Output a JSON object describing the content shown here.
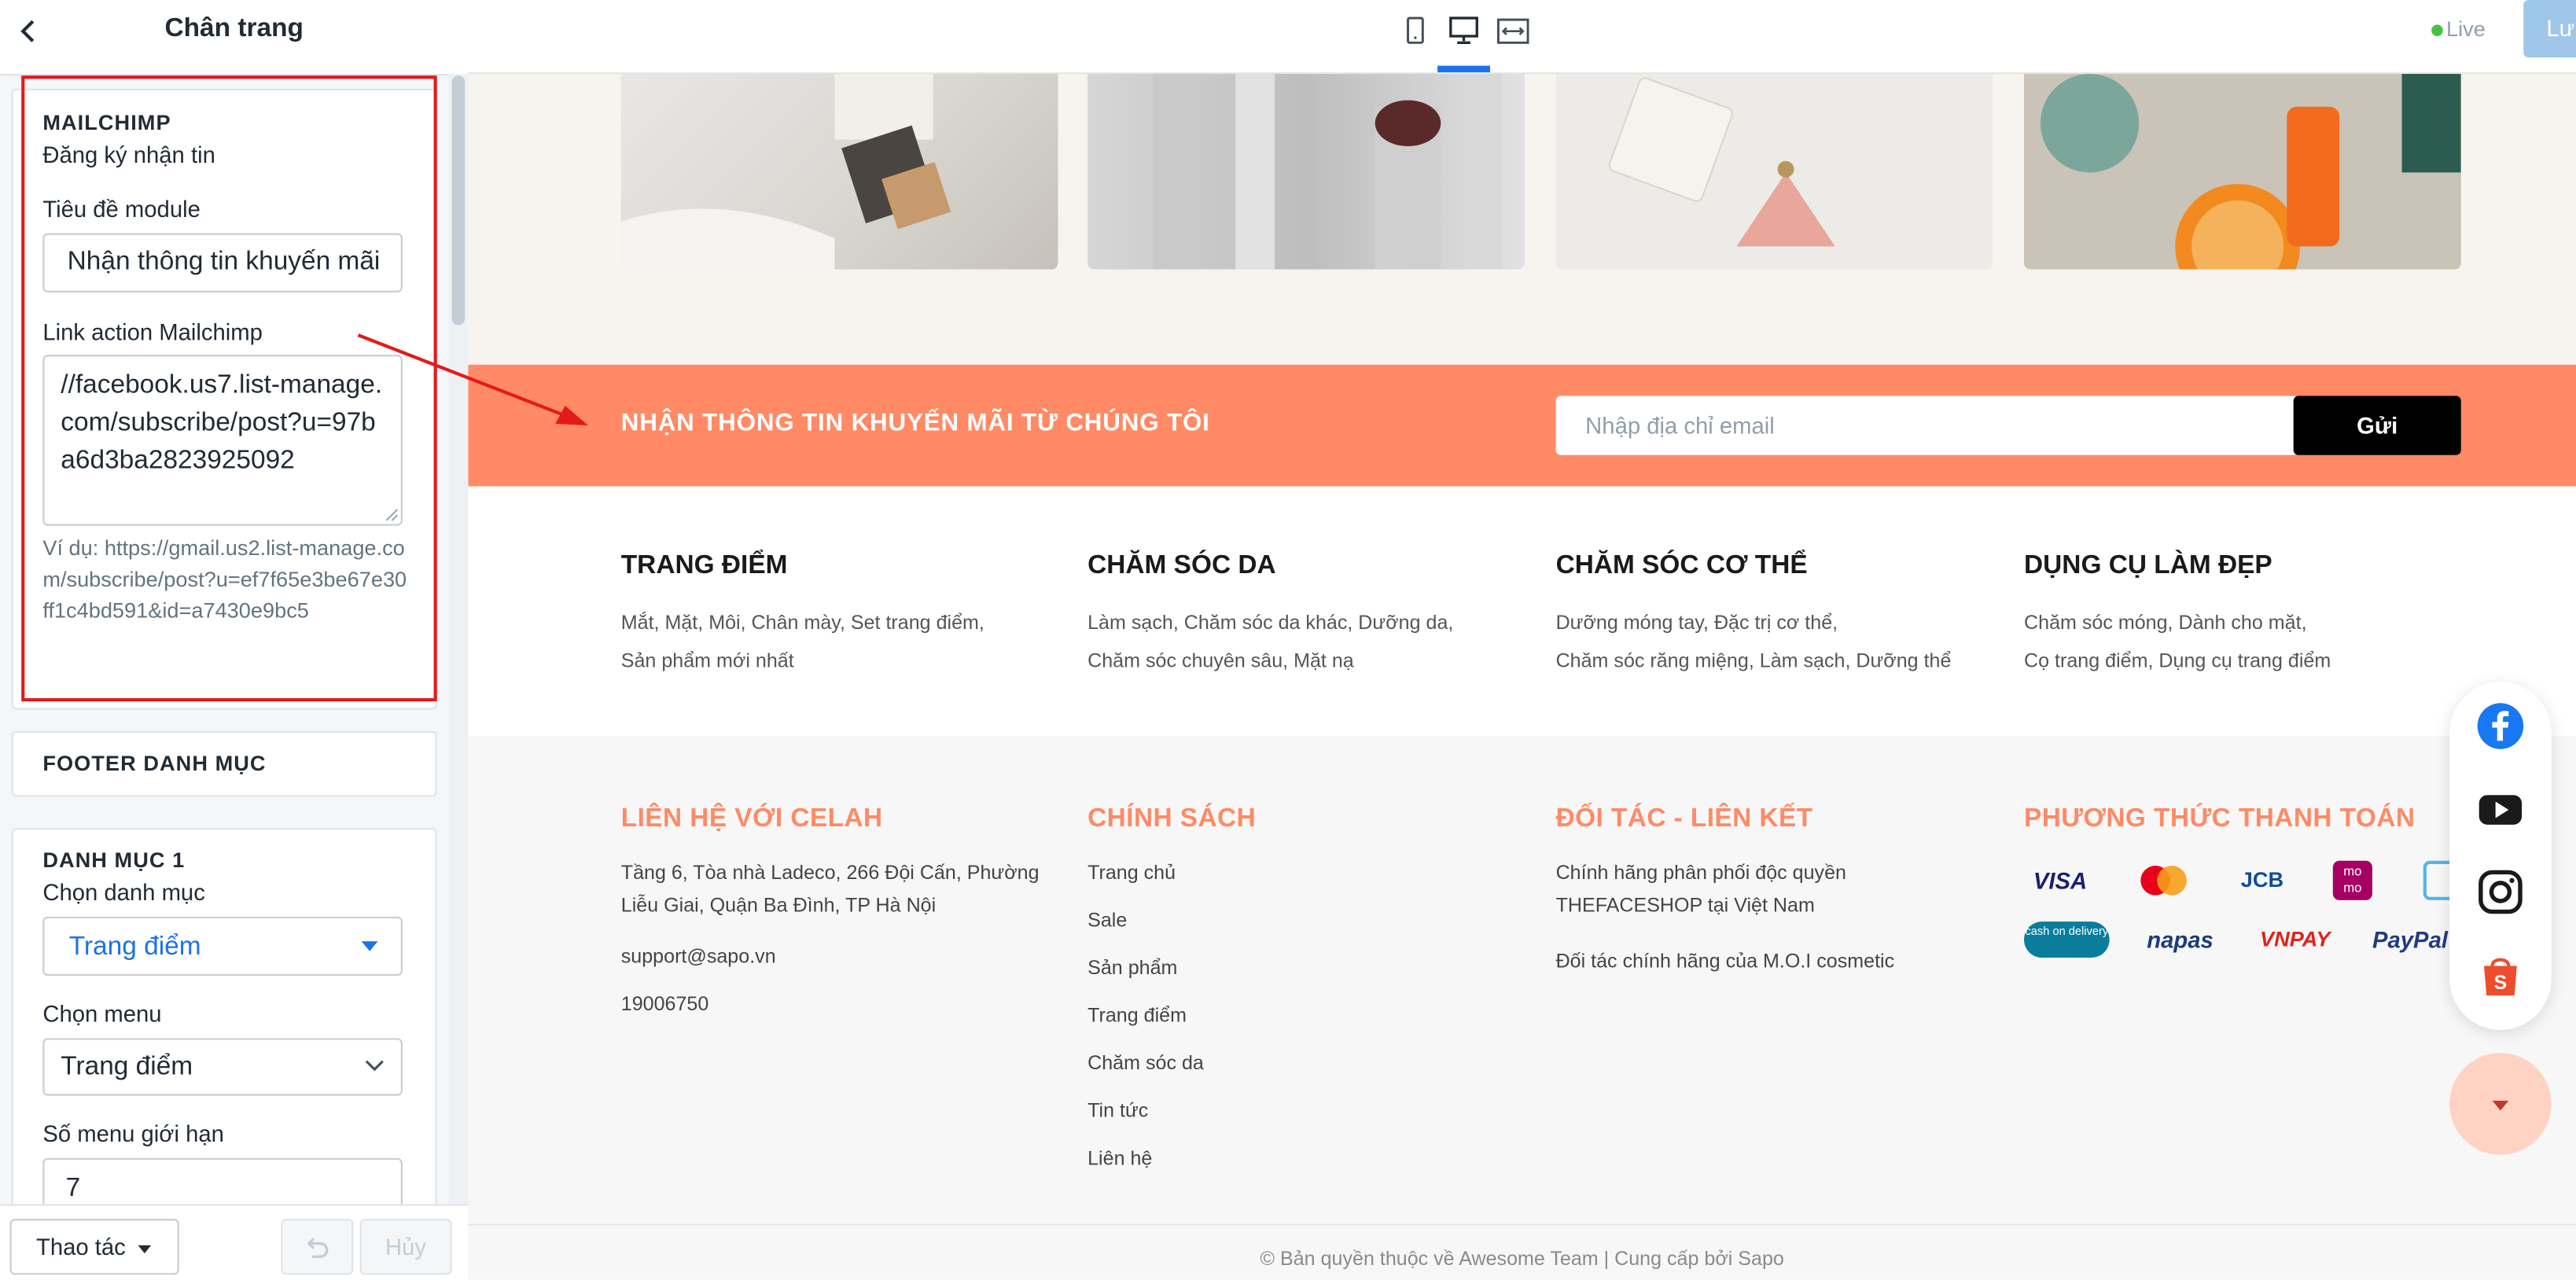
{
  "sidebar": {
    "title": "Chân trang",
    "mailchimp": {
      "section_title": "MAILCHIMP",
      "subtitle": "Đăng ký nhận tin",
      "module_title_label": "Tiêu đề module",
      "module_title_value": "Nhận thông tin khuyến mãi",
      "link_label": "Link action Mailchimp",
      "link_value": "//facebook.us7.list-manage.com/subscribe/post?u=97ba6d3ba2823925092",
      "example": "Ví dụ: https://gmail.us2.list-manage.com/subscribe/post?u=ef7f65e3be67e30ff1c4bd591&id=a7430e9bc5"
    },
    "footer_categories": {
      "section_title": "FOOTER DANH MỤC"
    },
    "category1": {
      "section_title": "DANH MỤC 1",
      "choose_category_label": "Chọn danh mục",
      "choose_category_value": "Trang điểm",
      "choose_menu_label": "Chọn menu",
      "choose_menu_value": "Trang điểm",
      "menu_limit_label": "Số menu giới hạn",
      "menu_limit_value": "7"
    },
    "footer_actions": {
      "action_label": "Thao tác",
      "cancel_label": "Hủy"
    }
  },
  "topbar": {
    "live_label": "Live",
    "save_label": "Lưu",
    "devices": [
      "mobile",
      "desktop",
      "fullwidth"
    ],
    "active_device": "desktop"
  },
  "preview": {
    "newsletter": {
      "heading": "NHẬN THÔNG TIN KHUYẾN MÃI TỪ CHÚNG TÔI",
      "placeholder": "Nhập địa chỉ email",
      "button": "Gửi"
    },
    "categories": [
      {
        "title": "TRANG ĐIỂM",
        "line1": "Mắt, Mặt, Môi, Chân mày, Set trang điểm,",
        "line2": "Sản phẩm mới nhất"
      },
      {
        "title": "CHĂM SÓC DA",
        "line1": "Làm sạch, Chăm sóc da khác, Dưỡng da,",
        "line2": "Chăm sóc chuyên sâu, Mặt nạ"
      },
      {
        "title": "CHĂM SÓC CƠ THỂ",
        "line1": "Dưỡng móng tay, Đặc trị cơ thể,",
        "line2": "Chăm sóc răng miệng, Làm sạch, Dưỡng thể"
      },
      {
        "title": "DỤNG CỤ LÀM ĐẸP",
        "line1": "Chăm sóc móng, Dành cho mặt,",
        "line2": "Cọ trang điểm, Dụng cụ trang điểm"
      }
    ],
    "contact": {
      "title": "LIÊN HỆ VỚI CELAH",
      "address": "Tầng 6, Tòa nhà Ladeco, 266 Đội Cấn, Phường Liễu Giai, Quận Ba Đình, TP Hà Nội",
      "email": "support@sapo.vn",
      "phone": "19006750"
    },
    "policy": {
      "title": "CHÍNH SÁCH",
      "links": [
        "Trang chủ",
        "Sale",
        "Sản phẩm",
        "Trang điểm",
        "Chăm sóc da",
        "Tin tức",
        "Liên hệ"
      ]
    },
    "partners": {
      "title": "ĐỐI TÁC - LIÊN KẾT",
      "text1": "Chính hãng phân phối độc quyền THEFACESHOP tại Việt Nam",
      "text2": "Đối tác chính hãng của M.O.I cosmetic"
    },
    "payment": {
      "title": "PHƯƠNG THỨC THANH TOÁN",
      "methods": [
        "VISA",
        "napas",
        "VNPAY",
        "PayPal"
      ],
      "cod_label": "cash on delivery",
      "momo_label": "mo mo",
      "jcb_label": "JCB"
    },
    "copyright": "© Bản quyền thuộc về Awesome Team | Cung cấp bởi Sapo",
    "social": [
      "facebook-icon",
      "youtube-icon",
      "instagram-icon",
      "shopee-icon"
    ]
  },
  "colors": {
    "accent": "#ff8a65",
    "highlight": "#e41a1a",
    "primary_link": "#1a73e8"
  }
}
